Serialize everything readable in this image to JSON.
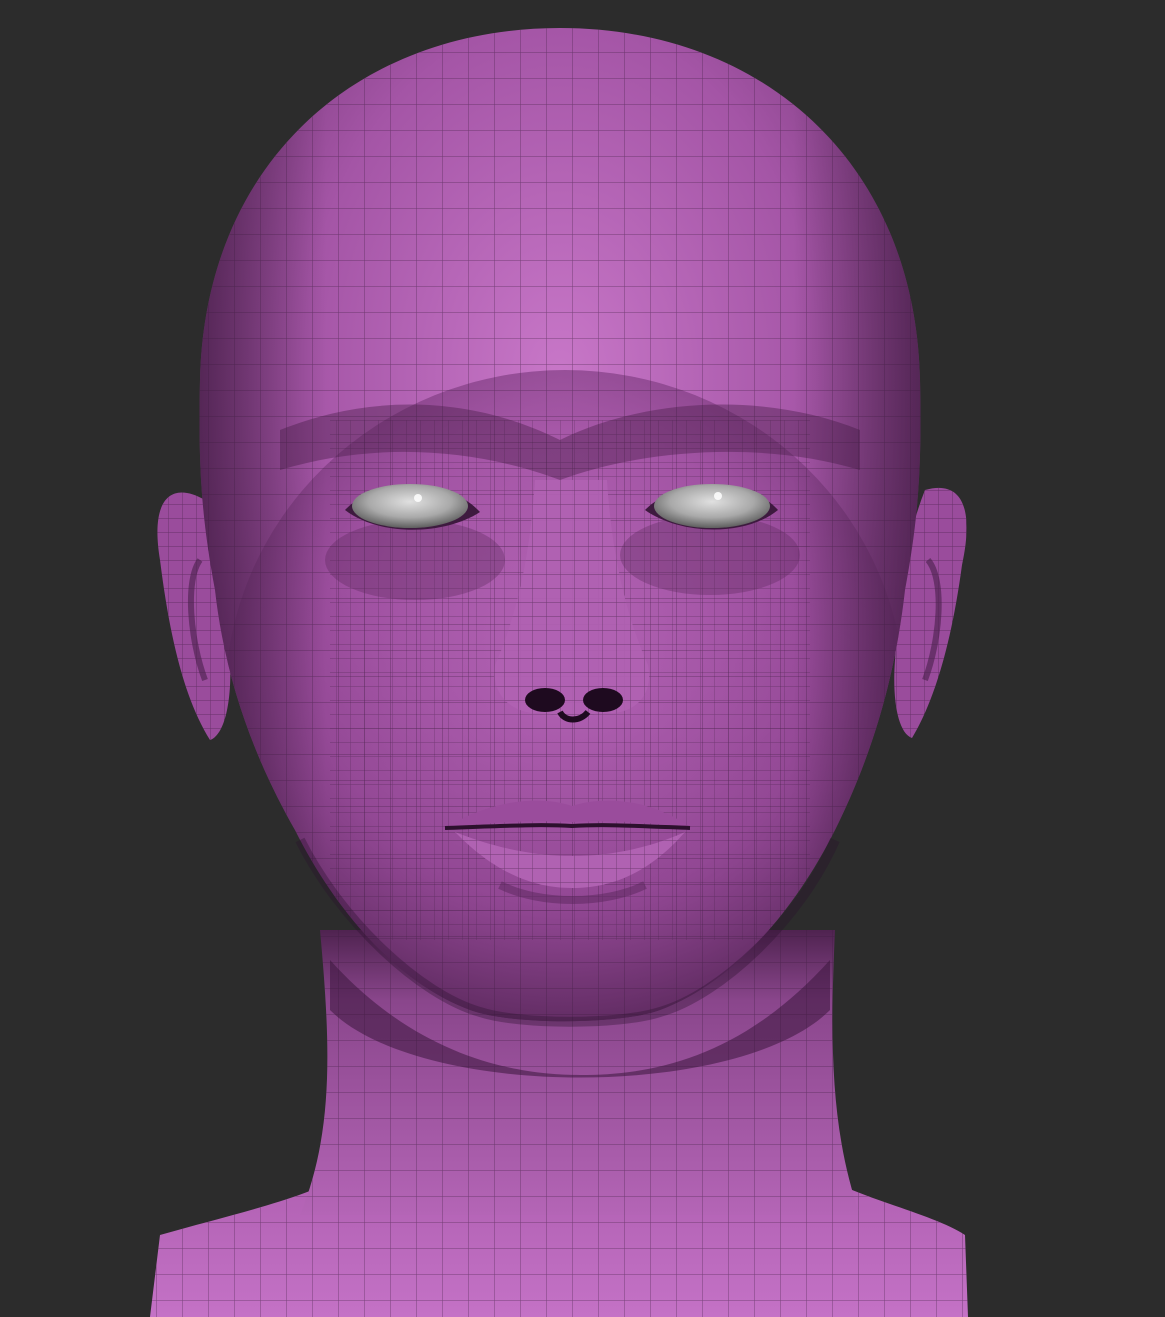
{
  "scene": {
    "background_color": "#2c2c2c",
    "subject": "sculpted-head-wireframe",
    "colors": {
      "skin_light": "#c877c8",
      "skin_mid": "#a455a6",
      "skin_dark": "#6e3270",
      "skin_shadow": "#3f1a40",
      "wire": "#3a1c3c",
      "eye_white": "#c9c9c9",
      "eye_shadow": "#7a7a7a"
    }
  }
}
